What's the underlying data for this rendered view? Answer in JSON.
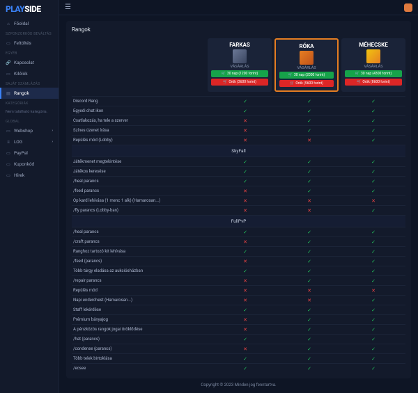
{
  "logo": {
    "p1": "PLAY",
    "p2": "SIDE"
  },
  "sidebar": {
    "home": "Főoldal",
    "sections": {
      "szponz": "SZPONZORKÓD BEVÁLTÁS",
      "egyeb": "EGYÉB",
      "szamla": "SAJÁT SZÁMLÁZÁS",
      "kategoria": "KATEGÓRIÁK",
      "kategoria_empty": "Nem található kategória.",
      "global": "GLOBAL"
    },
    "items": {
      "feltoltes": "Feltöltés",
      "kapcsolat": "Kapcsolat",
      "kilolok": "Kilólók",
      "rangok": "Rangok",
      "webshop": "Webshop",
      "log": "LOG",
      "paypal": "PayPal",
      "kuponkod": "Kuponkód",
      "hirek": "Hírek"
    }
  },
  "panel_title": "Rangok",
  "ranks": [
    {
      "key": "farkas",
      "name": "FARKAS",
      "sub": "VÁSÁRLÁS",
      "btn1": "30 nap (1200 forint)",
      "btn2": "Örök (3600 forint)",
      "highlight": false
    },
    {
      "key": "roka",
      "name": "RÓKA",
      "sub": "VÁSÁRLÁS",
      "btn1": "30 nap (2000 forint)",
      "btn2": "Örök (5600 forint)",
      "highlight": true
    },
    {
      "key": "mehecske",
      "name": "MÉHECSKE",
      "sub": "VÁSÁRLÁS",
      "btn1": "30 nap (4300 forint)",
      "btn2": "Örök (8600 forint)",
      "highlight": false
    }
  ],
  "features": [
    {
      "label": "Discord Rang",
      "v": [
        1,
        1,
        1
      ]
    },
    {
      "label": "Egyedi chat ikon",
      "v": [
        1,
        1,
        1
      ]
    },
    {
      "label": "Csatlakozás, ha tele a szerver",
      "v": [
        0,
        1,
        1
      ]
    },
    {
      "label": "Színes üzenet írása",
      "v": [
        0,
        1,
        1
      ]
    },
    {
      "label": "Repülés mód (Lobby)",
      "v": [
        0,
        0,
        1
      ]
    },
    {
      "section": "SkyFall"
    },
    {
      "label": "Játékmenet megtekintése",
      "v": [
        1,
        1,
        1
      ]
    },
    {
      "label": "Játékos keresése",
      "v": [
        1,
        1,
        1
      ]
    },
    {
      "label": "/heal parancs",
      "v": [
        1,
        1,
        1
      ]
    },
    {
      "label": "/feed parancs",
      "v": [
        0,
        1,
        1
      ]
    },
    {
      "label": "Op kard lehívása (1 menc 1 alk) (Hamarosan...)",
      "v": [
        0,
        0,
        0
      ]
    },
    {
      "label": "/fly parancs (Lobby-ban)",
      "v": [
        0,
        0,
        1
      ]
    },
    {
      "section": "FullPvP"
    },
    {
      "label": "/heal parancs",
      "v": [
        1,
        1,
        1
      ]
    },
    {
      "label": "/craft parancs",
      "v": [
        0,
        1,
        1
      ]
    },
    {
      "label": "Ranghoz tartozó kit lehívása",
      "v": [
        1,
        1,
        1
      ]
    },
    {
      "label": "/feed (parancs)",
      "v": [
        0,
        1,
        1
      ]
    },
    {
      "label": "Több tárgy eladása az aukciósházban",
      "v": [
        1,
        1,
        1
      ]
    },
    {
      "label": "/repair parancs",
      "v": [
        0,
        1,
        1
      ]
    },
    {
      "label": "Repülés mód",
      "v": [
        0,
        0,
        0
      ]
    },
    {
      "label": "Napi enderchest (Hamarosan...)",
      "v": [
        0,
        0,
        1
      ]
    },
    {
      "label": "Staff lekérdése",
      "v": [
        1,
        1,
        1
      ]
    },
    {
      "label": "Prémium bányajog",
      "v": [
        0,
        1,
        1
      ]
    },
    {
      "label": "A pénzközös rangok jogai öröklődése",
      "v": [
        0,
        1,
        1
      ]
    },
    {
      "label": "/hat (parancs)",
      "v": [
        1,
        1,
        1
      ]
    },
    {
      "label": "/condense (parancs)",
      "v": [
        0,
        1,
        1
      ]
    },
    {
      "label": "Több telek birtoklása",
      "v": [
        1,
        1,
        1
      ]
    },
    {
      "label": "/ecsee",
      "v": [
        1,
        1,
        1
      ]
    }
  ],
  "footer": "Copyright © 2023 Minden jog fenntartva."
}
